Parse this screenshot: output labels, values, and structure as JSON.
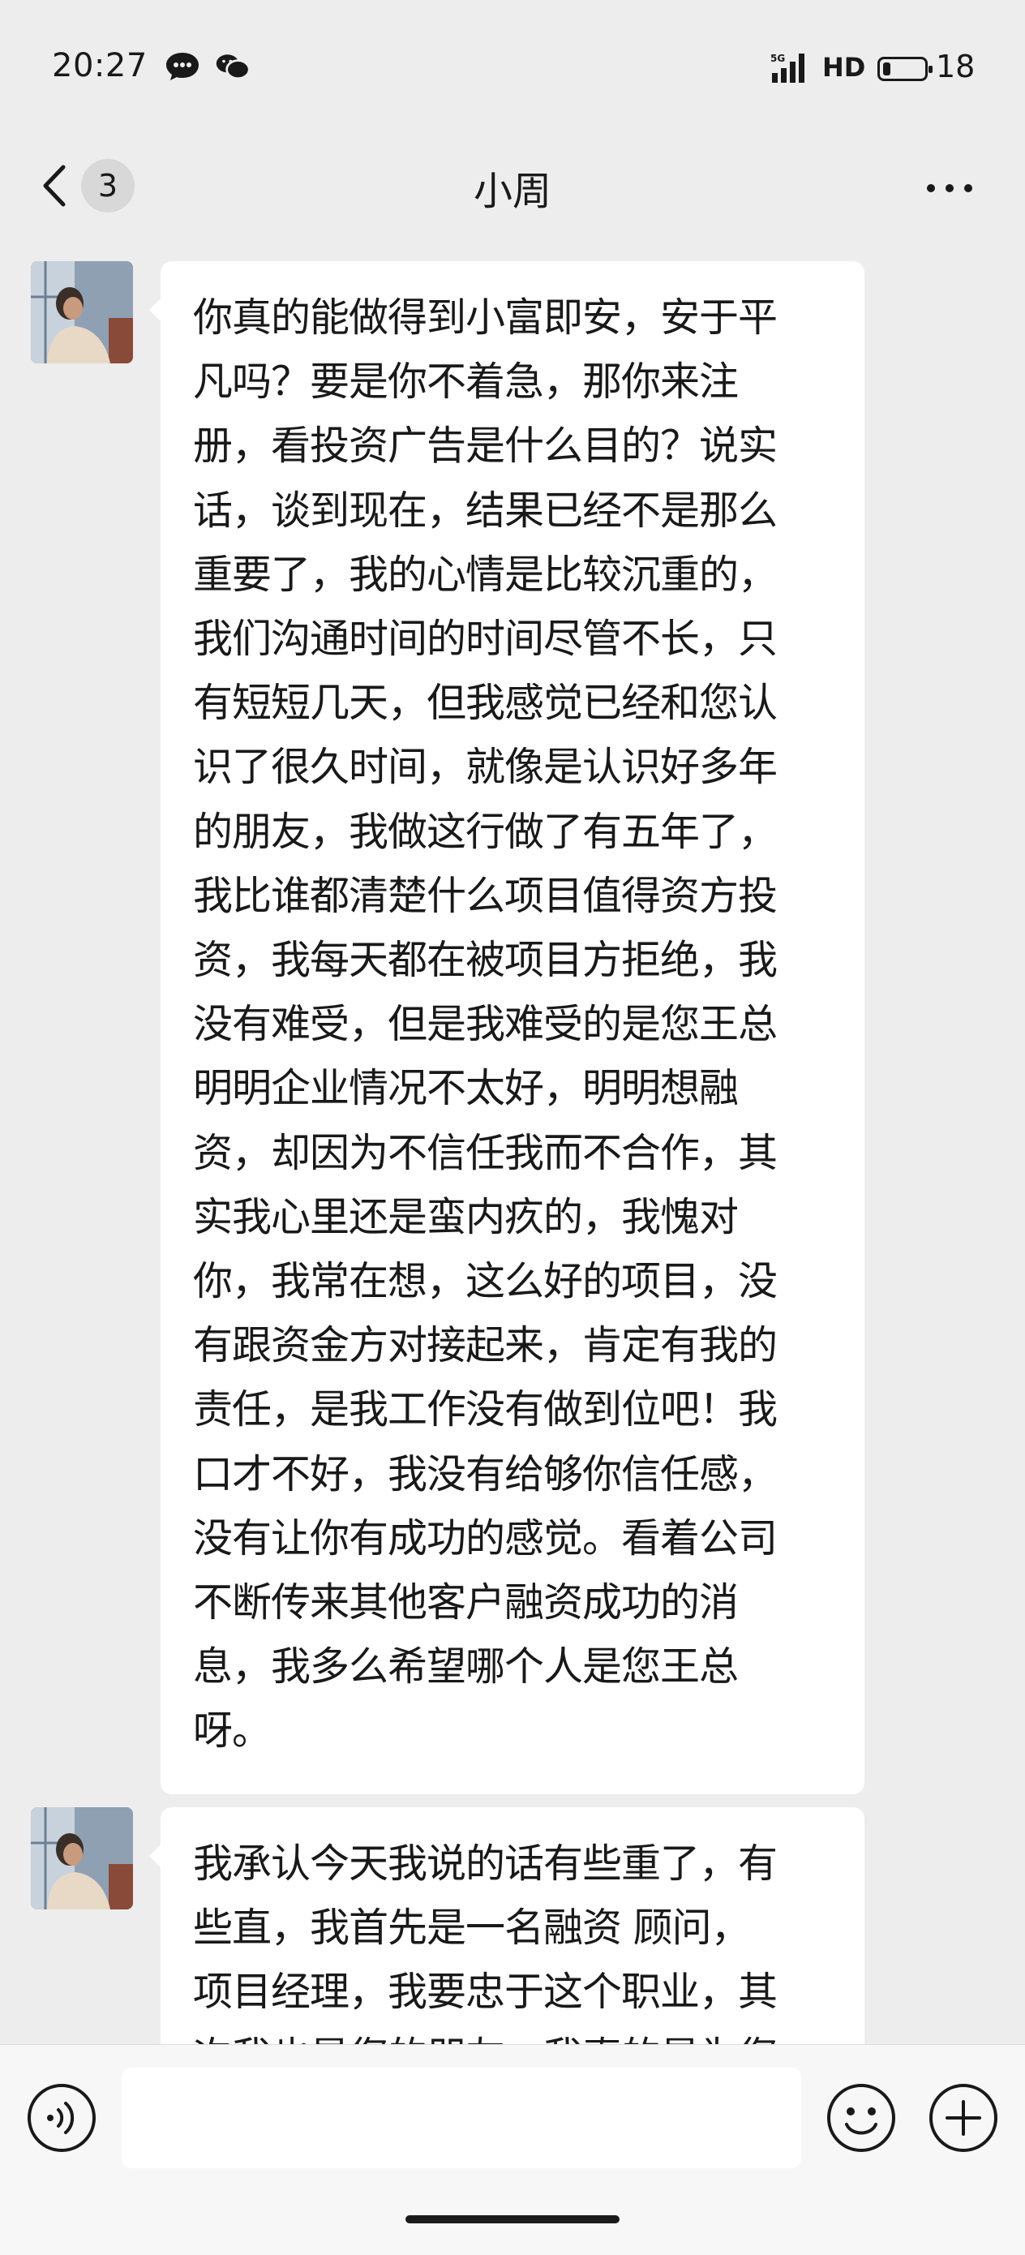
{
  "status_bar": {
    "time": "20:27",
    "app_icons": [
      "message-bubble-icon",
      "wechat-icon"
    ],
    "signal_label": "5G",
    "network": "HD",
    "battery_level": "18",
    "battery_fraction": 0.18
  },
  "header": {
    "back_icon": "chevron-left-icon",
    "unread_count": "3",
    "title": "小周",
    "more_icon": "more-horizontal-icon"
  },
  "messages": [
    {
      "lines": [
        "你真的能做得到小富即安，安于平",
        "凡吗？要是你不着急，那你来注",
        "册，看投资广告是什么目的？说实",
        "话，谈到现在，结果已经不是那么",
        "重要了，我的心情是比较沉重的，",
        "我们沟通时间的时间尽管不长，只",
        "有短短几天，但我感觉已经和您认",
        "识了很久时间，就像是认识好多年",
        "的朋友，我做这行做了有五年了，",
        "我比谁都清楚什么项目值得资方投",
        "资，我每天都在被项目方拒绝，我",
        "没有难受，但是我难受的是您王总",
        "明明企业情况不太好，明明想融",
        "资，却因为不信任我而不合作，其",
        "实我心里还是蛮内疚的，我愧对",
        "你，我常在想，这么好的项目，没",
        "有跟资金方对接起来，肯定有我的",
        "责任，是我工作没有做到位吧！我",
        "口才不好，我没有给够你信任感，",
        "没有让你有成功的感觉。看着公司",
        "不断传来其他客户融资成功的消",
        "息，我多么希望哪个人是您王总",
        "呀。"
      ]
    },
    {
      "lines": [
        "我承认今天我说的话有些重了，有",
        "些直，我首先是一名融资 顾问，",
        "项目经理，我要忠于这个职业，其",
        "次我也是您的朋友，我真的是为您"
      ]
    }
  ],
  "input_bar": {
    "voice_icon": "voice-input-icon",
    "text_value": "",
    "emoji_icon": "emoji-icon",
    "plus_icon": "plus-circle-icon"
  }
}
